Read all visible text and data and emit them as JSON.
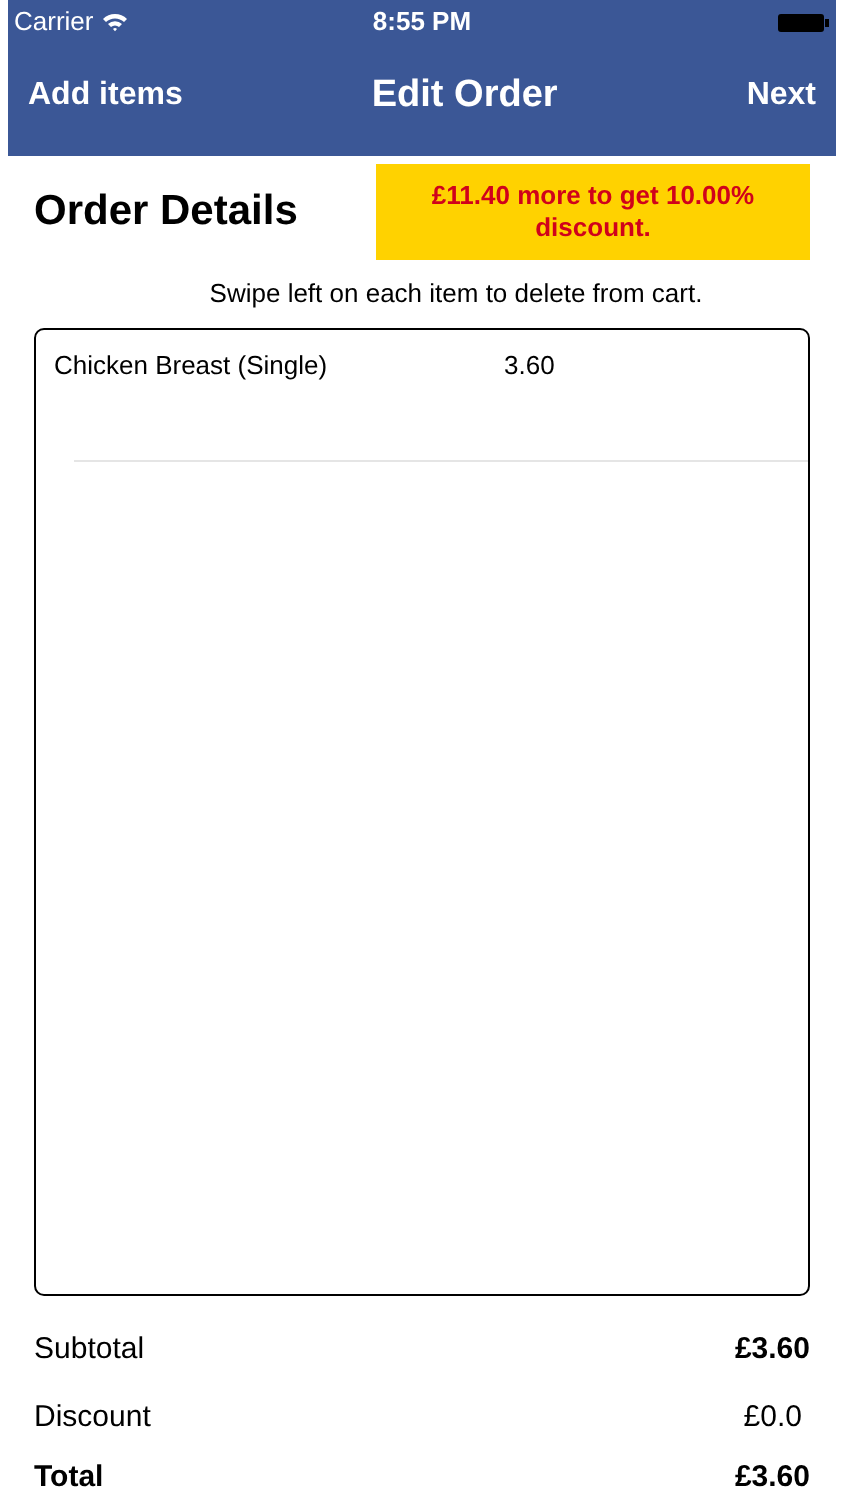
{
  "status_bar": {
    "carrier": "Carrier",
    "time": "8:55 PM"
  },
  "nav_bar": {
    "left": "Add items",
    "title": "Edit Order",
    "right": "Next"
  },
  "header": {
    "title": "Order Details",
    "promo": "£11.40 more to get 10.00% discount."
  },
  "hint": "Swipe left on each item to delete from cart.",
  "cart_items": [
    {
      "name": "Chicken Breast (Single)",
      "price": "3.60"
    }
  ],
  "summary": [
    {
      "kind": "subtotal",
      "label": "Subtotal",
      "value": "£3.60"
    },
    {
      "kind": "discount",
      "label": "Discount",
      "value": "£0.0"
    },
    {
      "kind": "total",
      "label": "Total",
      "value": "£3.60"
    }
  ]
}
